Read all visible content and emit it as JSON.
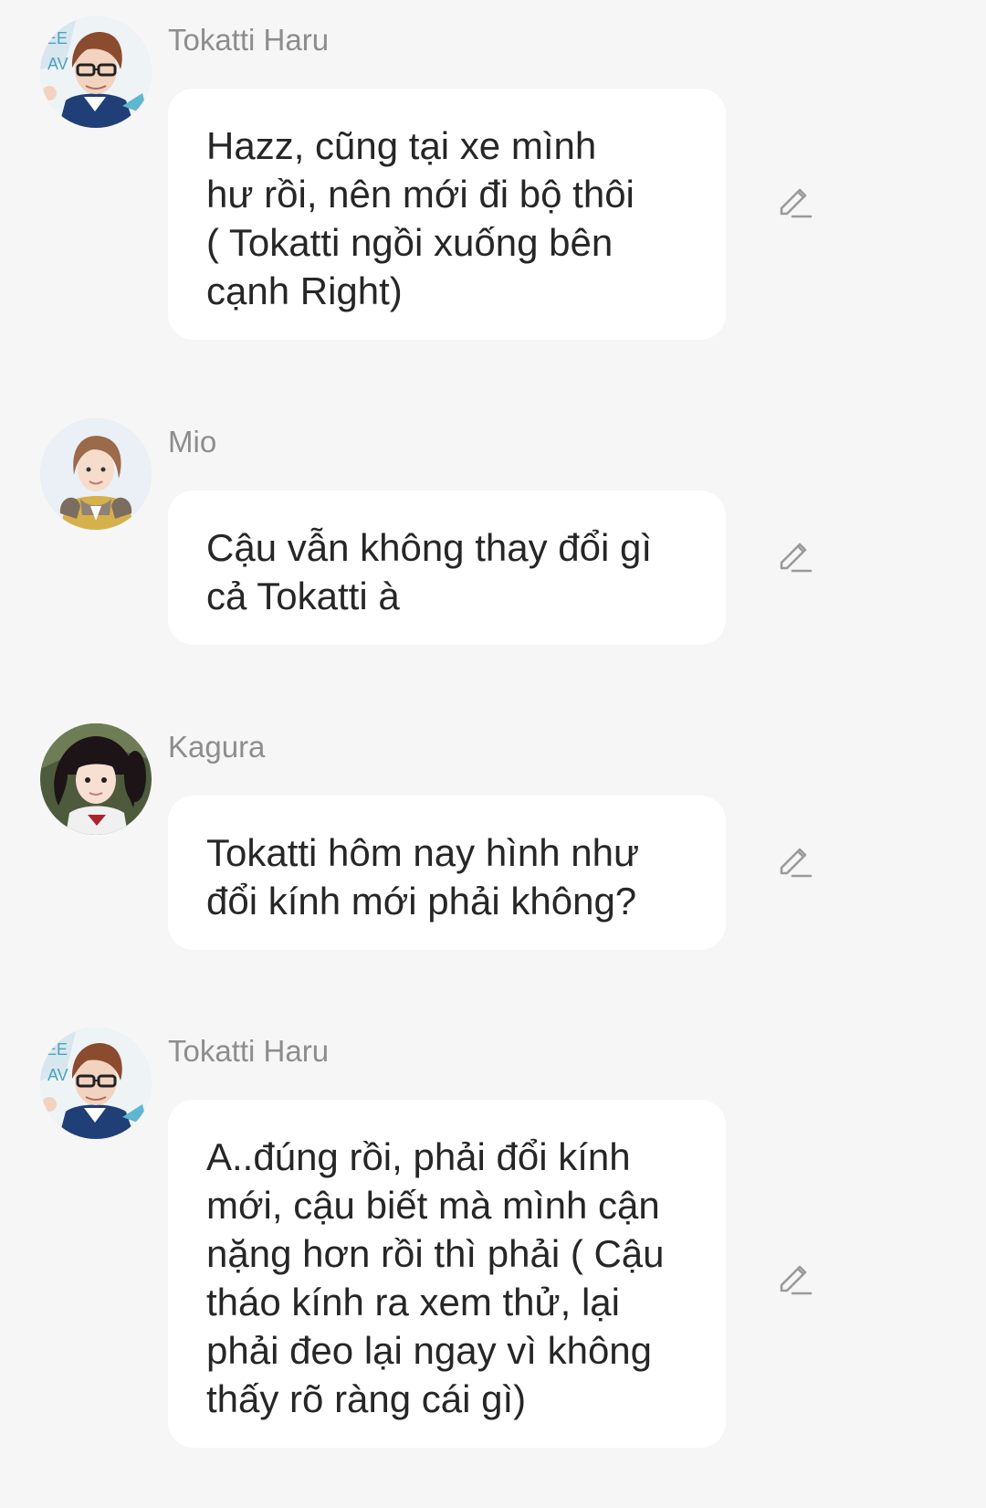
{
  "messages": [
    {
      "sender": "Tokatti Haru",
      "avatar": "tokatti-avatar",
      "text": "Hazz, cũng tại xe mình\như rồi,  nên mới đi bộ thôi\n( Tokatti ngồi xuống bên\ncạnh Right)",
      "icon": "pencil-icon"
    },
    {
      "sender": "Mio",
      "avatar": "mio-avatar",
      "text": "Cậu vẫn không thay đổi gì\ncả Tokatti à",
      "icon": "pencil-icon"
    },
    {
      "sender": "Kagura",
      "avatar": "kagura-avatar",
      "text": "Tokatti hôm nay hình như\nđổi kính mới phải không?",
      "icon": "pencil-icon"
    },
    {
      "sender": "Tokatti Haru",
      "avatar": "tokatti-avatar",
      "text": "A..đúng rồi,  phải đổi kính\nmới, cậu biết mà mình cận\nnặng hơn rồi thì phải ( Cậu\ntháo kính ra xem thử,  lại\nphải đeo lại ngay vì không\nthấy rõ ràng cái gì)",
      "icon": "pencil-icon"
    }
  ],
  "colors": {
    "background": "#f6f6f6",
    "bubble": "#ffffff",
    "sender_name": "#8d8d8d",
    "message_text": "#262626",
    "edit_icon": "#9a9a9a"
  }
}
